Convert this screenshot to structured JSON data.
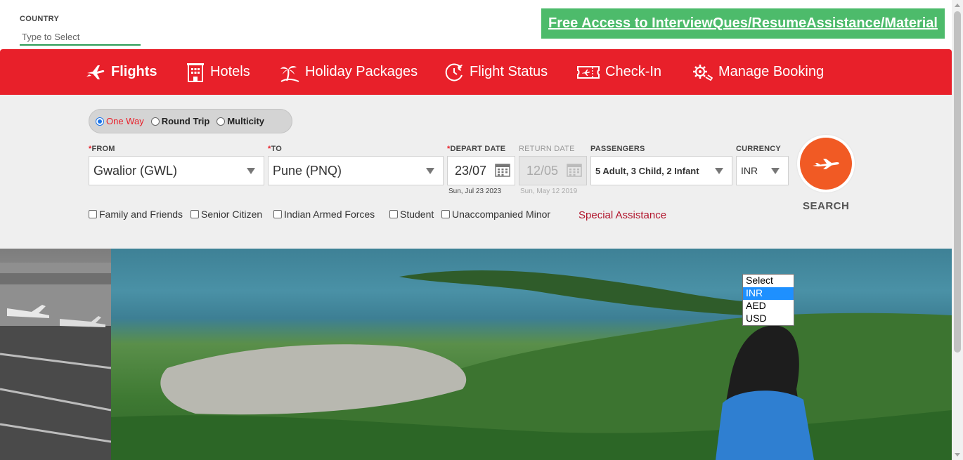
{
  "header": {
    "country_label": "COUNTRY",
    "country_placeholder": "Type to Select",
    "promo_link": "Free Access to InterviewQues/ResumeAssistance/Material"
  },
  "nav": {
    "items": [
      {
        "label": "Flights",
        "icon": "plane-icon",
        "active": true
      },
      {
        "label": "Hotels",
        "icon": "hotel-icon"
      },
      {
        "label": "Holiday Packages",
        "icon": "palm-tree-icon"
      },
      {
        "label": "Flight Status",
        "icon": "clock-plane-icon"
      },
      {
        "label": "Check-In",
        "icon": "boarding-pass-icon"
      },
      {
        "label": "Manage Booking",
        "icon": "gear-icon"
      }
    ]
  },
  "trip_type": {
    "options": [
      {
        "label": "One Way",
        "checked": true
      },
      {
        "label": "Round Trip",
        "checked": false
      },
      {
        "label": "Multicity",
        "checked": false
      }
    ]
  },
  "form": {
    "from_label": "FROM",
    "from_value": "Gwalior (GWL)",
    "to_label": "TO",
    "to_value": "Pune (PNQ)",
    "depart_label": "DEPART DATE",
    "depart_value": "23/07",
    "depart_full": "Sun, Jul 23 2023",
    "return_label": "RETURN DATE",
    "return_value": "12/05",
    "return_full": "Sun, May 12 2019",
    "passengers_label": "PASSENGERS",
    "passengers_value": "5 Adult, 3 Child, 2 Infant",
    "currency_label": "CURRENCY",
    "currency_value": "INR",
    "required_mark": "*"
  },
  "concessions": [
    "Family and Friends",
    "Senior Citizen",
    "Indian Armed Forces",
    "Student",
    "Unaccompanied Minor"
  ],
  "special_assistance": "Special Assistance",
  "search_label": "SEARCH",
  "currency_dropdown": {
    "options": [
      "Select",
      "INR",
      "AED",
      "USD"
    ],
    "highlighted": "INR"
  },
  "colors": {
    "brand_red": "#e8202a",
    "promo_green": "#4dbb6b",
    "search_orange": "#f15a24",
    "link_red": "#b1152c"
  }
}
